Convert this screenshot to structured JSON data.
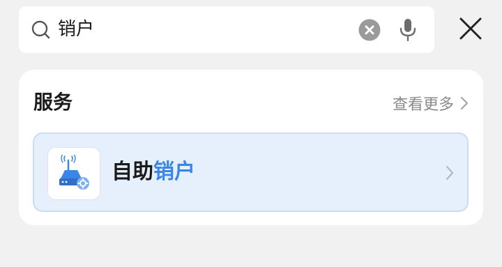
{
  "search": {
    "value": "销户",
    "icon": "search-icon",
    "clear_icon": "clear-icon",
    "mic_icon": "microphone-icon"
  },
  "close_icon": "close-icon",
  "services": {
    "title": "服务",
    "see_more_label": "查看更多",
    "items": [
      {
        "label_prefix": "自助",
        "label_highlight": "销户",
        "icon": "router-settings-icon"
      }
    ]
  },
  "colors": {
    "background": "#f1f1f1",
    "highlight": "#3a86e6",
    "item_background": "#e6f0fc"
  }
}
